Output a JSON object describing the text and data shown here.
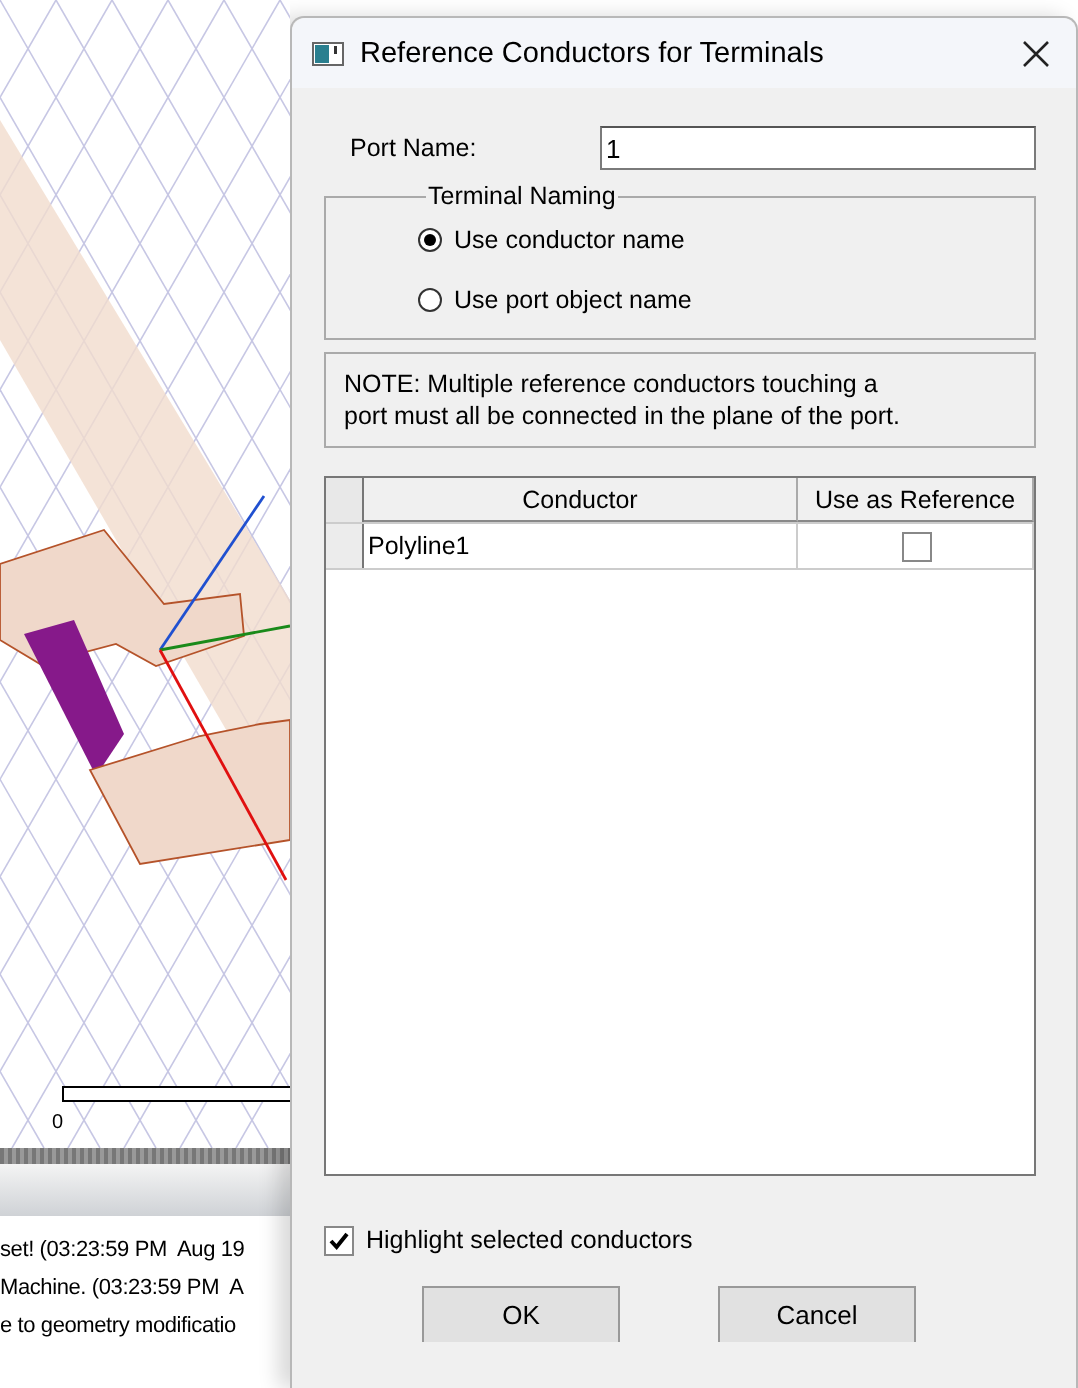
{
  "background_app": {
    "scale_label": "0",
    "log_lines": [
      "set! (03:23:59 PM  Aug 19",
      "Machine. (03:23:59 PM  A",
      "e to geometry modificatio"
    ]
  },
  "dialog": {
    "title": "Reference Conductors for Terminals",
    "port_name": {
      "label": "Port Name:",
      "value": "1"
    },
    "terminal_naming": {
      "title": "Terminal Naming",
      "options": [
        {
          "label": "Use conductor name",
          "selected": true
        },
        {
          "label": "Use port object name",
          "selected": false
        }
      ]
    },
    "note": "NOTE: Multiple reference conductors touching a\nport must all be connected in the plane of the port.",
    "table": {
      "columns": [
        "Conductor",
        "Use as Reference"
      ],
      "rows": [
        {
          "conductor": "Polyline1",
          "use_as_reference": false
        }
      ]
    },
    "highlight": {
      "label": "Highlight selected conductors",
      "checked": true
    },
    "buttons": [
      "OK",
      "Cancel"
    ]
  }
}
